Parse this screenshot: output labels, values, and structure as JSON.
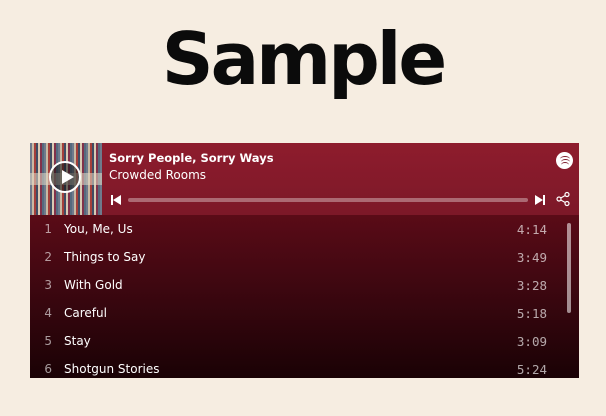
{
  "page": {
    "heading": "Sample"
  },
  "player": {
    "track_title": "Sorry People, Sorry Ways",
    "artist": "Crowded Rooms",
    "progress": 0,
    "colors": {
      "header": "#8e1c2d",
      "list_top": "#5a0b17",
      "list_bottom": "#1a0205",
      "background": "#f6ede1"
    },
    "icons": {
      "brand": "spotify-icon",
      "play": "play-icon",
      "previous": "skip-previous-icon",
      "next": "skip-next-icon",
      "share": "share-icon"
    },
    "tracks": [
      {
        "number": "1",
        "title": "You, Me, Us",
        "duration": "4:14"
      },
      {
        "number": "2",
        "title": "Things to Say",
        "duration": "3:49"
      },
      {
        "number": "3",
        "title": "With Gold",
        "duration": "3:28"
      },
      {
        "number": "4",
        "title": "Careful",
        "duration": "5:18"
      },
      {
        "number": "5",
        "title": "Stay",
        "duration": "3:09"
      },
      {
        "number": "6",
        "title": "Shotgun Stories",
        "duration": "5:24"
      }
    ]
  }
}
